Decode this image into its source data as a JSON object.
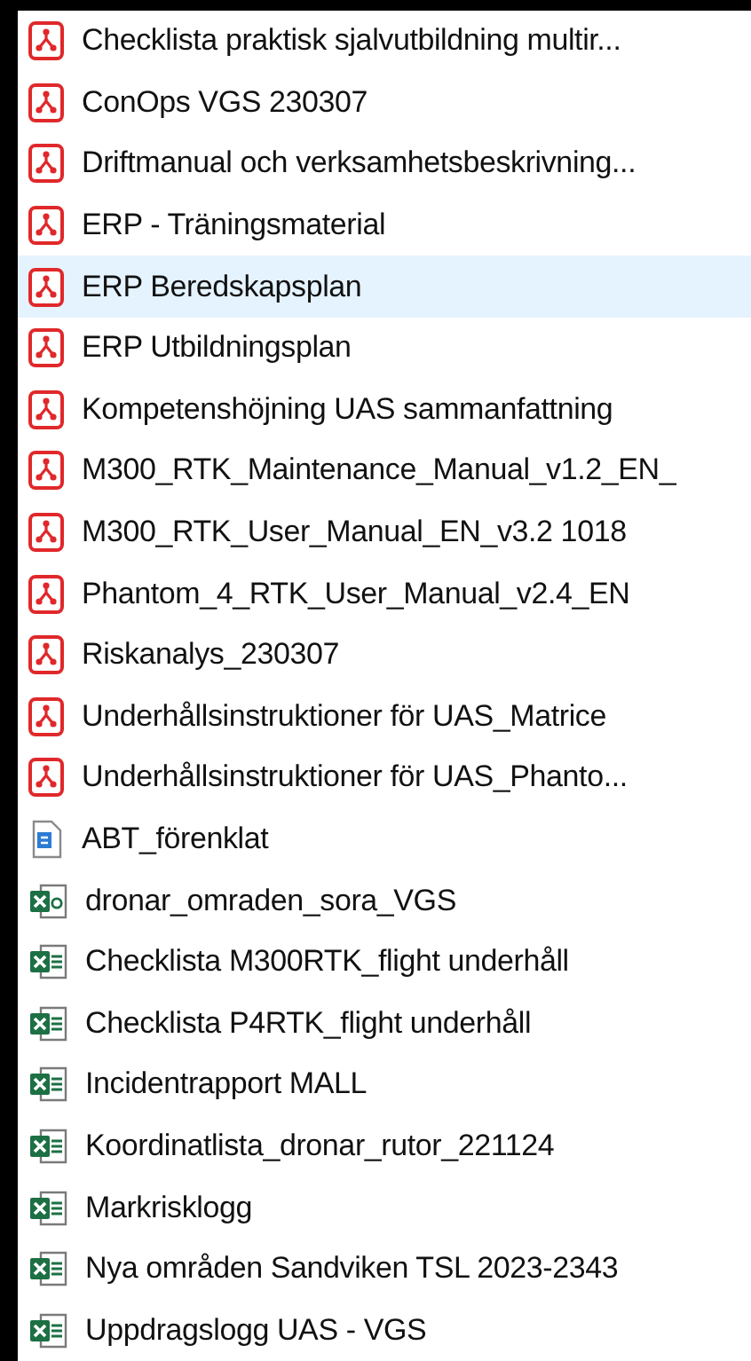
{
  "files": [
    {
      "name": "Checklista praktisk sjalvutbildning multir...",
      "kind": "pdf",
      "selected": false
    },
    {
      "name": "ConOps VGS 230307",
      "kind": "pdf",
      "selected": false
    },
    {
      "name": "Driftmanual och verksamhetsbeskrivning...",
      "kind": "pdf",
      "selected": false
    },
    {
      "name": "ERP - Träningsmaterial",
      "kind": "pdf",
      "selected": false
    },
    {
      "name": "ERP Beredskapsplan",
      "kind": "pdf",
      "selected": true
    },
    {
      "name": "ERP Utbildningsplan",
      "kind": "pdf",
      "selected": false
    },
    {
      "name": "Kompetenshöjning UAS sammanfattning",
      "kind": "pdf",
      "selected": false
    },
    {
      "name": "M300_RTK_Maintenance_Manual_v1.2_EN_",
      "kind": "pdf",
      "selected": false
    },
    {
      "name": "M300_RTK_User_Manual_EN_v3.2 1018",
      "kind": "pdf",
      "selected": false
    },
    {
      "name": "Phantom_4_RTK_User_Manual_v2.4_EN",
      "kind": "pdf",
      "selected": false
    },
    {
      "name": "Riskanalys_230307",
      "kind": "pdf",
      "selected": false
    },
    {
      "name": "Underhållsinstruktioner för UAS_Matrice",
      "kind": "pdf",
      "selected": false
    },
    {
      "name": "Underhållsinstruktioner för UAS_Phanto...",
      "kind": "pdf",
      "selected": false
    },
    {
      "name": "ABT_förenklat",
      "kind": "text",
      "selected": false
    },
    {
      "name": "dronar_omraden_sora_VGS",
      "kind": "csv",
      "selected": false
    },
    {
      "name": "Checklista M300RTK_flight underhåll",
      "kind": "sheet",
      "selected": false
    },
    {
      "name": "Checklista P4RTK_flight underhåll",
      "kind": "sheet",
      "selected": false
    },
    {
      "name": "Incidentrapport MALL",
      "kind": "sheet",
      "selected": false
    },
    {
      "name": "Koordinatlista_dronar_rutor_221124",
      "kind": "sheet",
      "selected": false
    },
    {
      "name": "Markrisklogg",
      "kind": "sheet",
      "selected": false
    },
    {
      "name": "Nya områden Sandviken TSL 2023-2343",
      "kind": "sheet",
      "selected": false
    },
    {
      "name": "Uppdragslogg UAS - VGS",
      "kind": "sheet",
      "selected": false
    }
  ]
}
